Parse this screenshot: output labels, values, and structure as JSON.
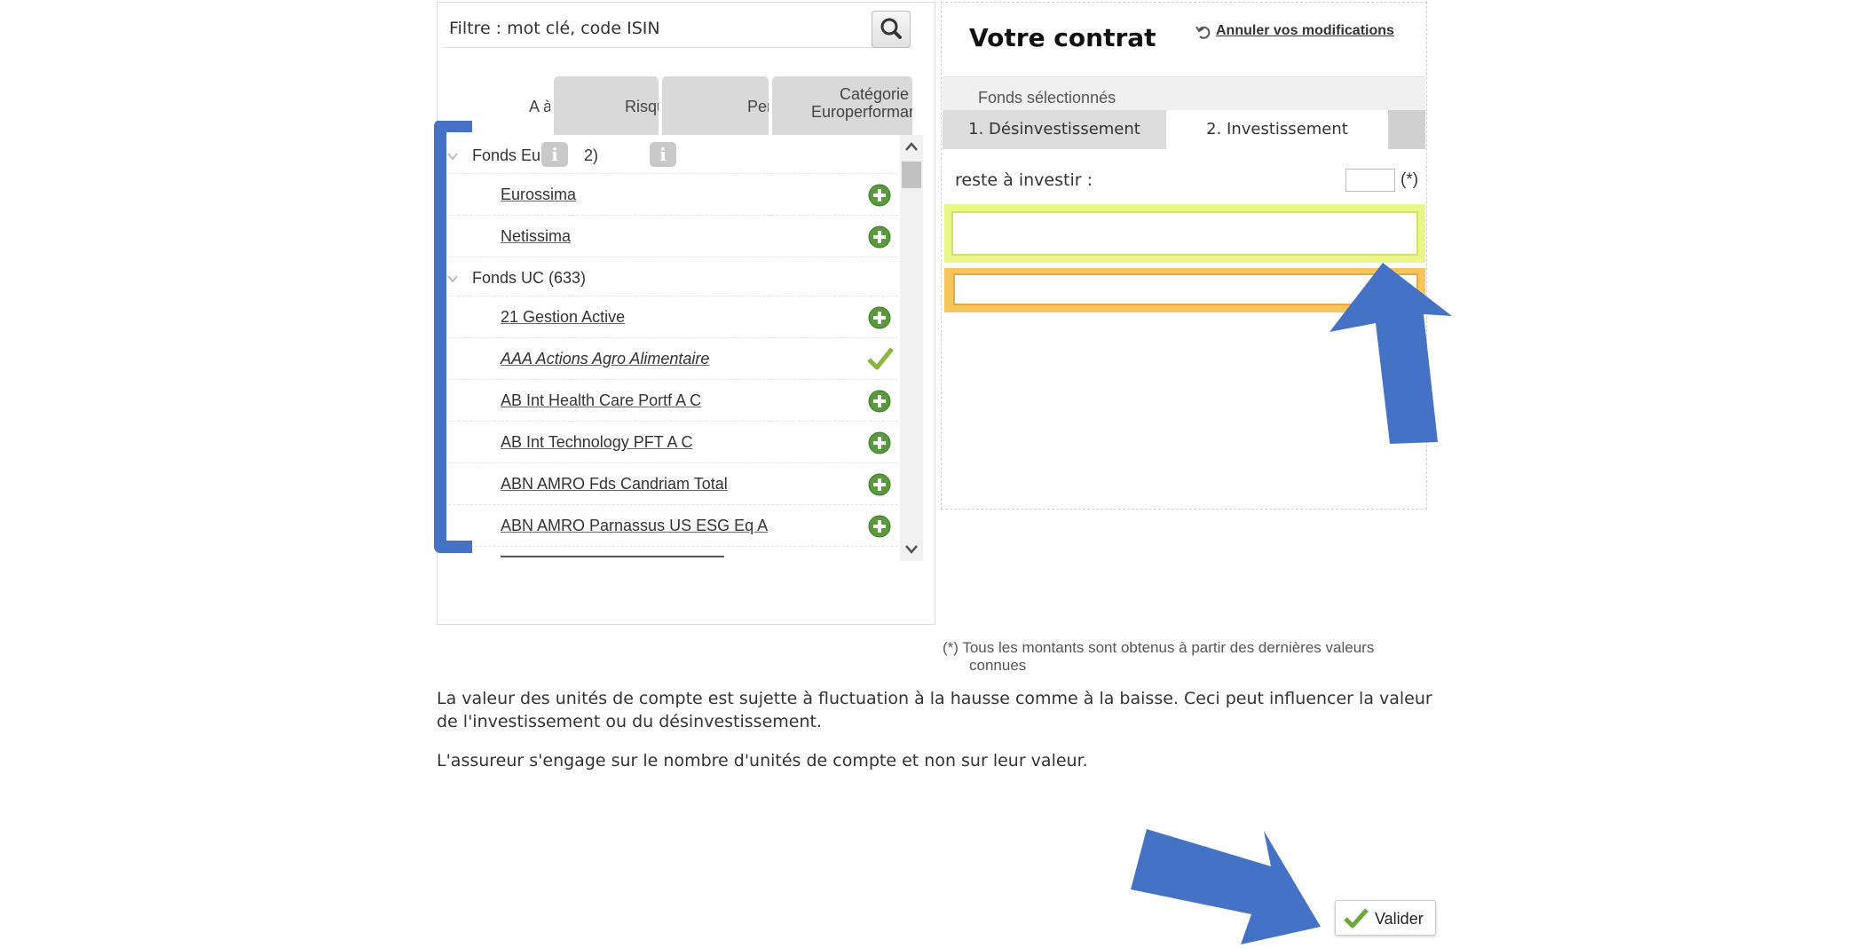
{
  "filter": {
    "placeholder": "Filtre : mot clé, code ISIN"
  },
  "columns": [
    {
      "label": "A à"
    },
    {
      "label": "Risqu"
    },
    {
      "label": "Per"
    },
    {
      "label_line1": "Catégorie",
      "label_line2": "Europerformance"
    }
  ],
  "info_badges": [
    "i",
    "i"
  ],
  "groups": {
    "euro": {
      "label": "Fonds Eu",
      "count_suffix": "2)"
    },
    "uc": {
      "label": "Fonds UC (633)"
    }
  },
  "funds": [
    {
      "label": "Eurossima",
      "status": "add"
    },
    {
      "label": "Netissima",
      "status": "add"
    },
    {
      "label": "21 Gestion Active",
      "status": "add"
    },
    {
      "label": "AAA Actions Agro Alimentaire",
      "status": "selected"
    },
    {
      "label": "AB Int Health Care Portf A C",
      "status": "add"
    },
    {
      "label": "AB Int Technology PFT A C",
      "status": "add"
    },
    {
      "label": "ABN AMRO Fds Candriam Total",
      "status": "add"
    },
    {
      "label": "ABN AMRO Parnassus US ESG Eq A",
      "status": "add"
    }
  ],
  "contract": {
    "title": "Votre contrat",
    "undo_label": "Annuler vos modifications",
    "selected_funds_label": "Fonds sélectionnés",
    "tabs": [
      {
        "label": "1. Désinvestissement",
        "active": false
      },
      {
        "label": "2. Investissement",
        "active": true
      }
    ],
    "remaining_label": "reste à investir :",
    "remaining_value": "",
    "remaining_mark": "(*)"
  },
  "footnote": {
    "line1": "(*) Tous les montants sont obtenus à partir des dernières valeurs",
    "line2": "connues"
  },
  "disclaimer": {
    "paragraph1": "La valeur des unités de compte est sujette à fluctuation à la hausse comme à la baisse. Ceci peut influencer la valeur de l'investissement ou du désinvestissement.",
    "paragraph2": "L'assureur s'engage sur le nombre d'unités de compte et non sur leur valeur."
  },
  "validate_button": {
    "label": "Valider"
  },
  "colors": {
    "annotation_blue": "#4472c4",
    "add_green": "#5a9a3c",
    "check_green": "#8ab73c",
    "highlight_yellow": "#e9f78a",
    "highlight_orange": "#f8c55a"
  }
}
